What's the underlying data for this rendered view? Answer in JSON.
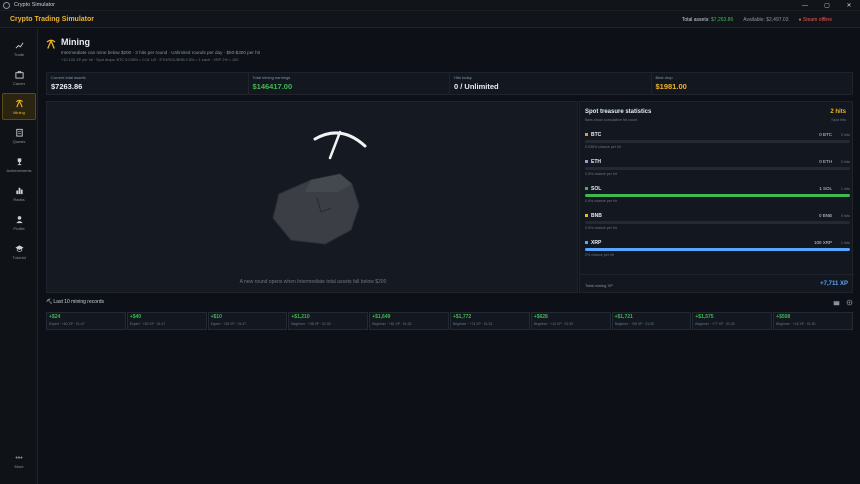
{
  "window": {
    "title": "Crypto Simulator",
    "minimize": "—",
    "maximize": "▢",
    "close": "✕"
  },
  "header": {
    "brand": "Crypto Trading Simulator",
    "total_assets_label": "Total assets:",
    "total_assets_value": "$7,263.86",
    "available_label": "Available:",
    "available_value": "$2,497.03",
    "steam_status": "● Steam offline"
  },
  "sidebar": {
    "items": [
      {
        "label": "Trade",
        "icon": "chart-line-icon"
      },
      {
        "label": "Career",
        "icon": "briefcase-icon"
      },
      {
        "label": "Mining",
        "icon": "pickaxe-icon",
        "active": true
      },
      {
        "label": "Quests",
        "icon": "clipboard-icon"
      },
      {
        "label": "Achievements",
        "icon": "trophy-icon"
      },
      {
        "label": "Ranks",
        "icon": "bar-chart-icon"
      },
      {
        "label": "Profile",
        "icon": "user-icon"
      },
      {
        "label": "Tutorial",
        "icon": "graduation-cap-icon"
      }
    ],
    "more_label": "More"
  },
  "page": {
    "title": "Mining",
    "subtitle": "Intermediate can mine below $200 · 3 hits per round · Unlimited rounds per day · $50-$300 per hit",
    "detail": "+10-100 XP per hit · Spot drops: BTC 0.038% = 0.01 US · ETH/SOL/BNB 0.5% = 1 each · XRP 2% = 100"
  },
  "stats": [
    {
      "label": "Current total assets",
      "value": "$7263.86",
      "color": "#e6edf3"
    },
    {
      "label": "Total mining earnings",
      "value": "$146417.00",
      "color": "#3fb950"
    },
    {
      "label": "Hits today",
      "value": "0 / Unlimited",
      "color": "#e6edf3"
    },
    {
      "label": "Best drop",
      "value": "$1981.00",
      "color": "#f0b429"
    }
  ],
  "mine": {
    "message": "A new round opens when Intermediate total assets fall below $200"
  },
  "treasure": {
    "title": "Spot treasure statistics",
    "subtitle": "Bars show cumulative hit count",
    "hits": "2 hits",
    "hits_sub": "Spot hits",
    "coins": [
      {
        "name": "BTC",
        "amount": "0 BTC",
        "hits": "0 hits",
        "chance": "0.038% chance per hit",
        "color": "#f7931a",
        "fill": 0
      },
      {
        "name": "ETH",
        "amount": "0 ETH",
        "hits": "0 hits",
        "chance": "0.5% chance per hit",
        "color": "#8ea0d8",
        "fill": 0
      },
      {
        "name": "SOL",
        "amount": "1 SOL",
        "hits": "1 hits",
        "chance": "0.5% chance per hit",
        "color": "#3fb950",
        "fill": 1
      },
      {
        "name": "BNB",
        "amount": "0 BNB",
        "hits": "0 hits",
        "chance": "0.5% chance per hit",
        "color": "#f0b429",
        "fill": 0
      },
      {
        "name": "XRP",
        "amount": "100 XRP",
        "hits": "1 hits",
        "chance": "2% chance per hit",
        "color": "#58a6ff",
        "fill": 1
      }
    ],
    "footer_label": "Total mining XP",
    "footer_value": "+7,711 XP"
  },
  "records": {
    "title": "Last 10 mining records",
    "items": [
      {
        "value": "+$24",
        "detail": "Expert · +60 XP · 01:47"
      },
      {
        "value": "+$40",
        "detail": "Expert · +82 XP · 01:47"
      },
      {
        "value": "+$10",
        "detail": "Expert · +28 XP · 01:47"
      },
      {
        "value": "+$1,210",
        "detail": "Beginner · +38 XP · 01:33"
      },
      {
        "value": "+$1,649",
        "detail": "Beginner · +81 XP · 01:33"
      },
      {
        "value": "+$1,772",
        "detail": "Beginner · +74 XP · 01:33"
      },
      {
        "value": "+$628",
        "detail": "Beginner · +14 XP · 01:30"
      },
      {
        "value": "+$1,721",
        "detail": "Beginner · +55 XP · 01:30"
      },
      {
        "value": "+$1,575",
        "detail": "Beginner · +77 XP · 01:30"
      },
      {
        "value": "+$508",
        "detail": "Beginner · +18 XP · 01:30"
      }
    ]
  }
}
